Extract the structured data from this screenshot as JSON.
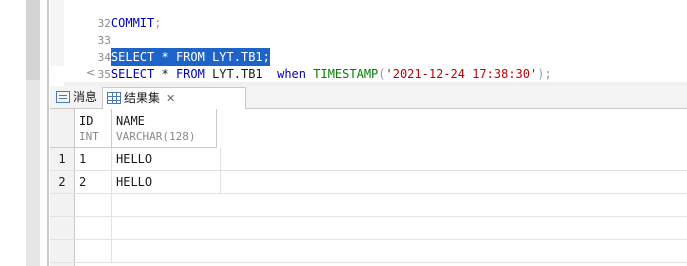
{
  "editor": {
    "lines": [
      {
        "num": "32",
        "text": "COMMIT;"
      },
      {
        "num": "33",
        "text": ""
      },
      {
        "num": "34",
        "text": "SELECT * FROM LYT.TB1;"
      },
      {
        "num": "35",
        "text": "SELECT * FROM LYT.TB1  when TIMESTAMP('2021-12-24 17:38:30');"
      }
    ],
    "line35": {
      "kw_select": "SELECT",
      "star": " * ",
      "kw_from": "FROM",
      "table": " LYT.TB1  ",
      "kw_when": "when",
      "fn_timestamp": " TIMESTAMP",
      "paren_open": "(",
      "str_value": "'2021-12-24 17:38:30'",
      "paren_close": ");"
    },
    "line34": {
      "kw_select": "SELECT",
      "star": " * ",
      "kw_from": "FROM",
      "table": " LYT.TB1;"
    },
    "line32": {
      "kw_commit": "COMMIT",
      "semi": ";"
    },
    "scroll_left_glyph": "<"
  },
  "tabs": [
    {
      "label": "消息",
      "icon": "message-icon"
    },
    {
      "label": "结果集",
      "icon": "grid-icon",
      "close": "✕"
    }
  ],
  "results": {
    "columns": [
      {
        "name": "ID",
        "type": "INT"
      },
      {
        "name": "NAME",
        "type": "VARCHAR(128)"
      }
    ],
    "rows": [
      {
        "rownum": "1",
        "ID": "1",
        "NAME": "HELLO"
      },
      {
        "rownum": "2",
        "ID": "2",
        "NAME": "HELLO"
      }
    ]
  }
}
